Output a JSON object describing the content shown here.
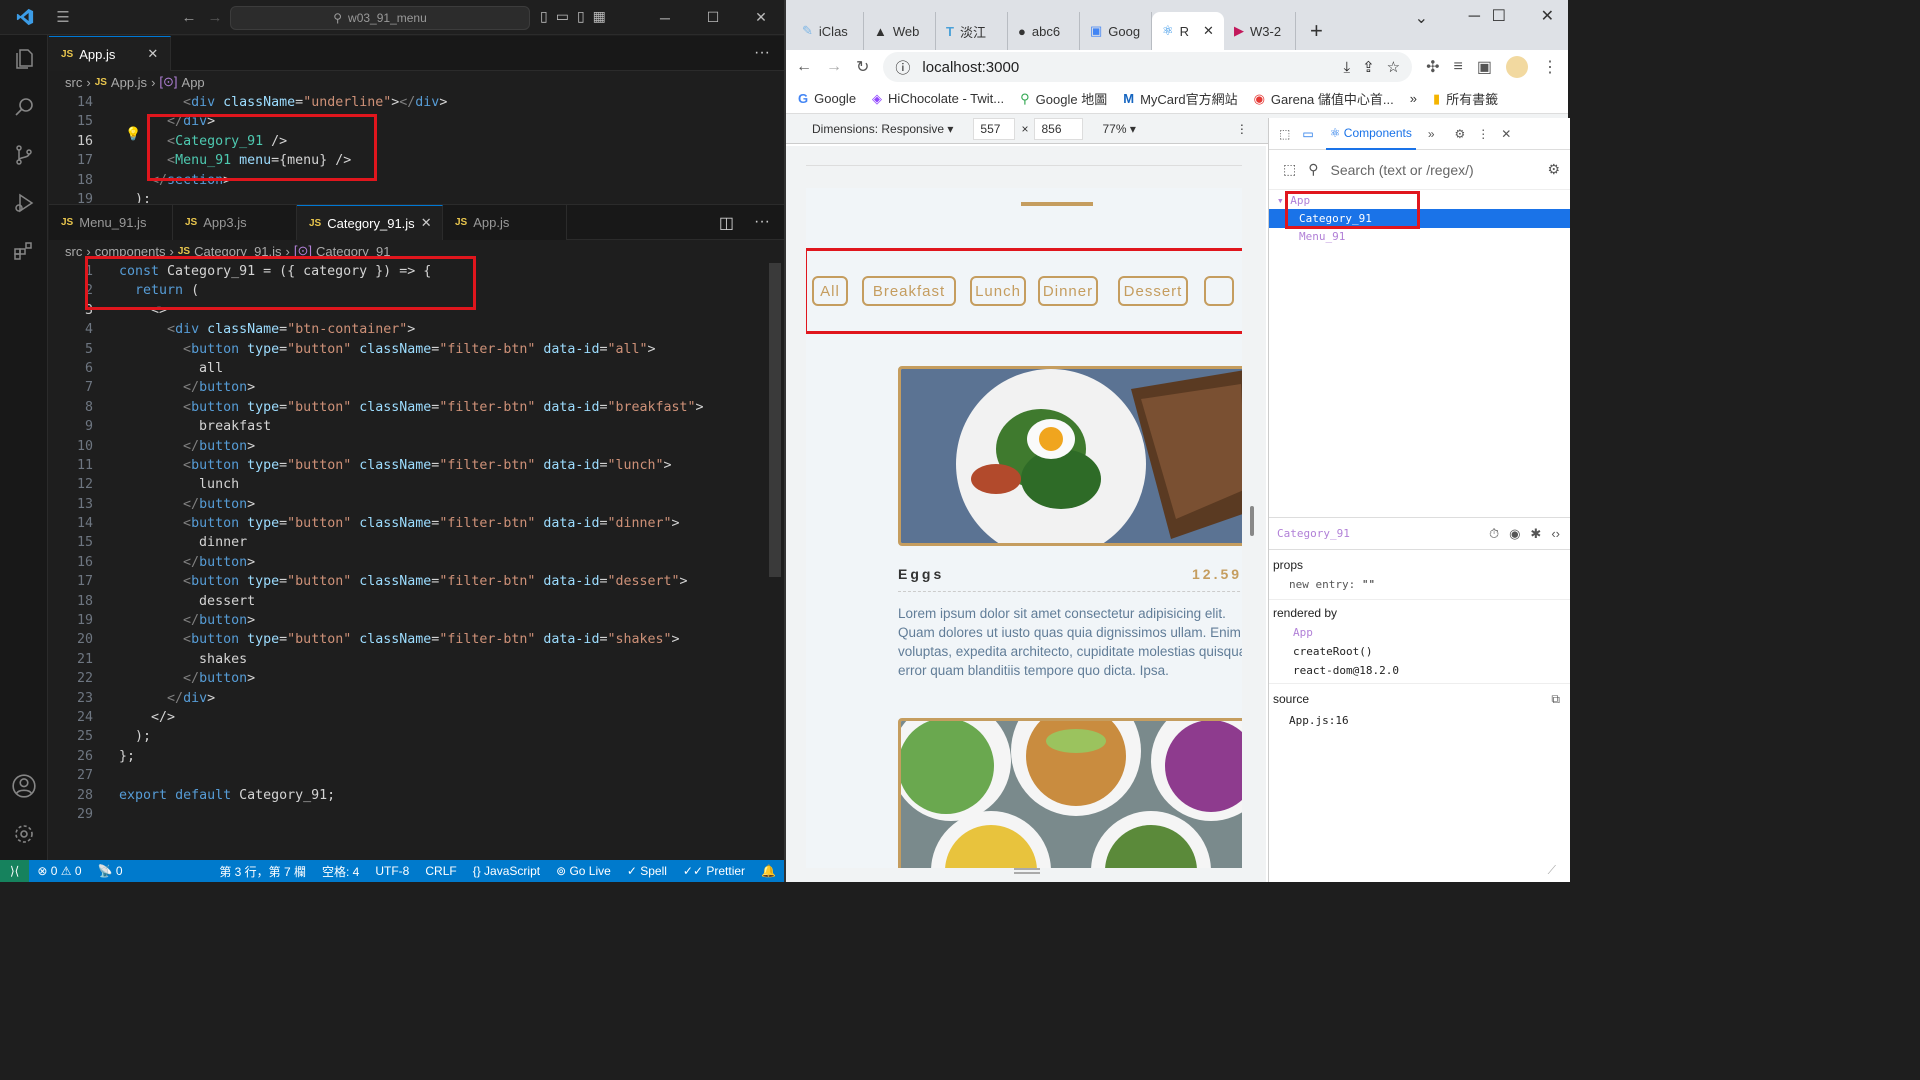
{
  "vscode": {
    "title": "w03_91_menu",
    "top_editor": {
      "tabs": [
        {
          "label": "App.js",
          "active": true
        }
      ],
      "breadcrumb": [
        "src",
        "App.js",
        "App"
      ],
      "lines": [
        {
          "n": "14",
          "code": "        <div className=\"underline\"></div>"
        },
        {
          "n": "15",
          "code": "      </div>"
        },
        {
          "n": "16",
          "code": "      <Category_91 />"
        },
        {
          "n": "17",
          "code": "      <Menu_91 menu={menu} />"
        },
        {
          "n": "18",
          "code": "    </section>"
        },
        {
          "n": "19",
          "code": "  );"
        }
      ]
    },
    "bottom_editor": {
      "tabs": [
        {
          "label": "Menu_91.js",
          "active": false
        },
        {
          "label": "App3.js",
          "active": false
        },
        {
          "label": "Category_91.js",
          "active": true
        },
        {
          "label": "App.js",
          "active": false
        }
      ],
      "breadcrumb": [
        "src",
        "components",
        "Category_91.js",
        "Category_91"
      ],
      "lines": [
        {
          "n": "1",
          "code": "const Category_91 = ({ category }) => {"
        },
        {
          "n": "2",
          "code": "  return ("
        },
        {
          "n": "3",
          "code": "    <>"
        },
        {
          "n": "4",
          "code": "      <div className=\"btn-container\">"
        },
        {
          "n": "5",
          "code": "        <button type=\"button\" className=\"filter-btn\" data-id=\"all\">"
        },
        {
          "n": "6",
          "code": "          all"
        },
        {
          "n": "7",
          "code": "        </button>"
        },
        {
          "n": "8",
          "code": "        <button type=\"button\" className=\"filter-btn\" data-id=\"breakfast\">"
        },
        {
          "n": "9",
          "code": "          breakfast"
        },
        {
          "n": "10",
          "code": "        </button>"
        },
        {
          "n": "11",
          "code": "        <button type=\"button\" className=\"filter-btn\" data-id=\"lunch\">"
        },
        {
          "n": "12",
          "code": "          lunch"
        },
        {
          "n": "13",
          "code": "        </button>"
        },
        {
          "n": "14",
          "code": "        <button type=\"button\" className=\"filter-btn\" data-id=\"dinner\">"
        },
        {
          "n": "15",
          "code": "          dinner"
        },
        {
          "n": "16",
          "code": "        </button>"
        },
        {
          "n": "17",
          "code": "        <button type=\"button\" className=\"filter-btn\" data-id=\"dessert\">"
        },
        {
          "n": "18",
          "code": "          dessert"
        },
        {
          "n": "19",
          "code": "        </button>"
        },
        {
          "n": "20",
          "code": "        <button type=\"button\" className=\"filter-btn\" data-id=\"shakes\">"
        },
        {
          "n": "21",
          "code": "          shakes"
        },
        {
          "n": "22",
          "code": "        </button>"
        },
        {
          "n": "23",
          "code": "      </div>"
        },
        {
          "n": "24",
          "code": "    </>"
        },
        {
          "n": "25",
          "code": "  );"
        },
        {
          "n": "26",
          "code": "};"
        },
        {
          "n": "27",
          "code": ""
        },
        {
          "n": "28",
          "code": "export default Category_91;"
        },
        {
          "n": "29",
          "code": ""
        }
      ]
    },
    "status": {
      "errors": "0",
      "warnings": "0",
      "ports": "0",
      "position": "第 3 行，第 7 欄",
      "spaces": "空格: 4",
      "encoding": "UTF-8",
      "eol": "CRLF",
      "language": "{} JavaScript",
      "golive": "Go Live",
      "spell": "Spell",
      "prettier": "Prettier"
    }
  },
  "chrome": {
    "tabs": [
      "iClas",
      "Web",
      "淡江",
      "abc6",
      "Goog",
      "R",
      "W3-2"
    ],
    "url": "localhost:3000",
    "bookmarks": [
      "Google",
      "HiChocolate - Twit...",
      "Google 地圖",
      "MyCard官方網站",
      "Garena 儲值中心首...",
      "所有書籤"
    ],
    "device": {
      "dimensions_label": "Dimensions: Responsive ▾",
      "width": "557",
      "height": "856",
      "zoom": "77% ▾"
    },
    "page": {
      "filters": [
        "All",
        "Breakfast",
        "Lunch",
        "Dinner",
        "Dessert"
      ],
      "item": {
        "title": "Eggs",
        "price": "12.59",
        "desc": "Lorem ipsum dolor sit amet consectetur adipisicing elit. Quam dolores ut iusto quas quia dignissimos ullam. Enim voluptas, expedita architecto, cupiditate molestias quisquam error quam blanditiis tempore quo dicta. Ipsa."
      }
    },
    "devtools": {
      "tab_label": "Components",
      "search_placeholder": "Search (text or /regex/)",
      "tree": [
        "App",
        "Category_91",
        "Menu_91"
      ],
      "selected_component": "Category_91",
      "props_label": "props",
      "new_entry": "new entry:",
      "new_entry_value": "\"\"",
      "rendered_by_label": "rendered by",
      "rendered_by": [
        "App",
        "createRoot()",
        "react-dom@18.2.0"
      ],
      "source_label": "source",
      "source": "App.js:16"
    }
  }
}
